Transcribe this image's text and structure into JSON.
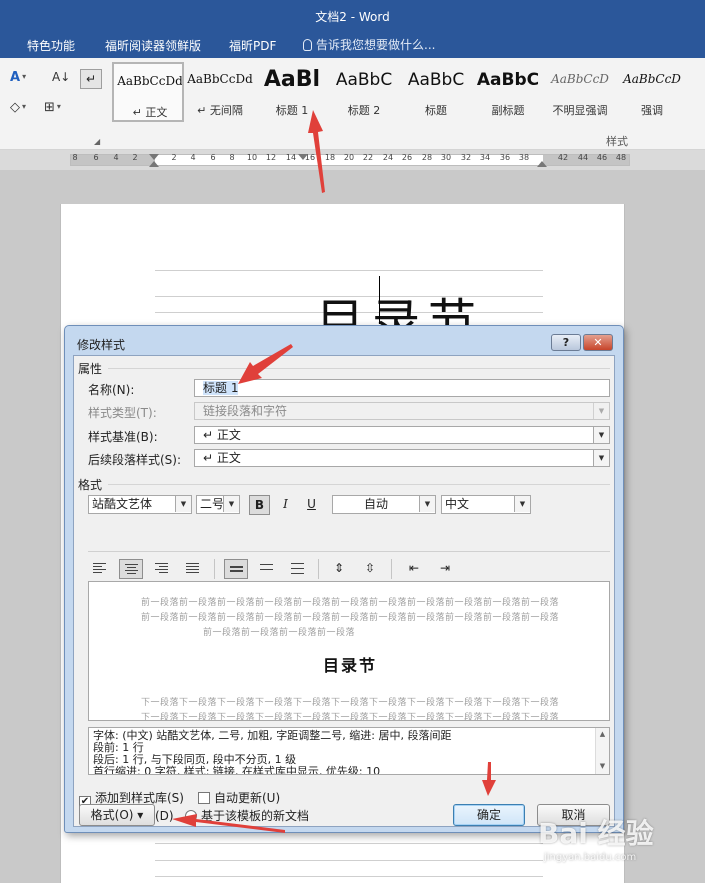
{
  "window": {
    "title": "文档2 - Word"
  },
  "menu": {
    "items": [
      "特色功能",
      "福昕阅读器领鲜版",
      "福昕PDF"
    ],
    "tell_me": "告诉我您想要做什么..."
  },
  "ribbon": {
    "styles": [
      {
        "preview": "AaBbCcDd",
        "name": "↵ 正文"
      },
      {
        "preview": "AaBbCcDd",
        "name": "↵ 无间隔"
      },
      {
        "preview": "AaBl",
        "name": "标题 1"
      },
      {
        "preview": "AaBbC",
        "name": "标题 2"
      },
      {
        "preview": "AaBbC",
        "name": "标题"
      },
      {
        "preview": "AaBbC",
        "name": "副标题"
      },
      {
        "preview": "AaBbCcD",
        "name": "不明显强调"
      },
      {
        "preview": "AaBbCcD",
        "name": "强调"
      }
    ],
    "group_label": "样式"
  },
  "ruler": {
    "numbers": [
      "8",
      "6",
      "4",
      "2",
      "2",
      "4",
      "6",
      "8",
      "10",
      "12",
      "14",
      "16",
      "18",
      "20",
      "22",
      "24",
      "26",
      "28",
      "30",
      "32",
      "34",
      "36",
      "38",
      "42",
      "44",
      "46",
      "48"
    ]
  },
  "document": {
    "heading": "目录节"
  },
  "dialog": {
    "title": "修改样式",
    "help_label": "?",
    "close_label": "✕",
    "properties_label": "属性",
    "name_label": "名称(N):",
    "name_value": "标题 1",
    "style_type_label": "样式类型(T):",
    "style_type_value": "链接段落和字符",
    "based_on_label": "样式基准(B):",
    "based_on_value": "↵ 正文",
    "following_label": "后续段落样式(S):",
    "following_value": "↵ 正文",
    "format_label": "格式",
    "font": "站酷文艺体",
    "size": "二号",
    "bold": "B",
    "italic": "I",
    "underline": "U",
    "color": "自动",
    "script": "中文",
    "preview_prev_lines": [
      "前一段落前一段落前一段落前一段落前一段落前一段落前一段落前一段落前一段落前一段落前一段落",
      "前一段落前一段落前一段落前一段落前一段落前一段落前一段落前一段落前一段落前一段落前一段落",
      "前一段落前一段落前一段落前一段落"
    ],
    "preview_heading": "目录节",
    "preview_next_lines": [
      "下一段落下一段落下一段落下一段落下一段落下一段落下一段落下一段落下一段落下一段落下一段落",
      "下一段落下一段落下一段落下一段落下一段落下一段落下一段落下一段落下一段落下一段落下一段落"
    ],
    "description_lines": [
      "字体: (中文) 站酷文艺体, 二号, 加粗, 字距调整二号, 缩进: 居中, 段落间距",
      "    段前: 1 行",
      "    段后: 1 行, 与下段同页, 段中不分页, 1 级",
      "    首行缩进: 0 字符, 样式: 链接, 在样式库中显示, 优先级: 10"
    ],
    "add_to_gallery_label": "添加到样式库(S)",
    "auto_update_label": "自动更新(U)",
    "only_this_doc_label": "仅限此文档(D)",
    "new_docs_label": "基于该模板的新文档",
    "format_button": "格式(O) ▾",
    "ok_button": "确定",
    "cancel_button": "取消"
  },
  "watermark": {
    "brand": "Bai 经验",
    "url": "jingyan.baidu.com"
  },
  "colors": {
    "title_bar": "#2b579a",
    "annotation_arrow": "#e0403a",
    "dialog_frame": "#c4d8ef"
  }
}
